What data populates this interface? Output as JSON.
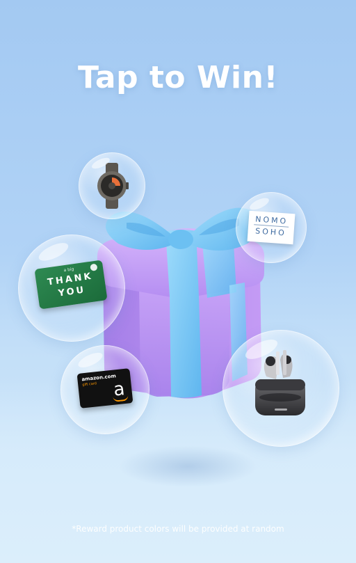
{
  "header": {
    "title": "Tap to Win!"
  },
  "rewards": {
    "thank_you_card": {
      "small_line": "a big",
      "line1": "THANK",
      "line2": "YOU"
    },
    "amazon_card": {
      "brand": "amazon.com",
      "sub": "gift card",
      "logo_letter": "a"
    },
    "nomo_card": {
      "line1": "NOMO",
      "line2": "SOHO"
    }
  },
  "footer": {
    "disclaimer": "*Reward product colors will be provided at random"
  },
  "colors": {
    "background_top": "#a3c9f2",
    "gift_box": "#b48ef0",
    "ribbon": "#7cc8f5",
    "title_text": "#ffffff"
  },
  "icons": [
    "gift-box-icon",
    "smartwatch-icon",
    "earbuds-icon"
  ]
}
